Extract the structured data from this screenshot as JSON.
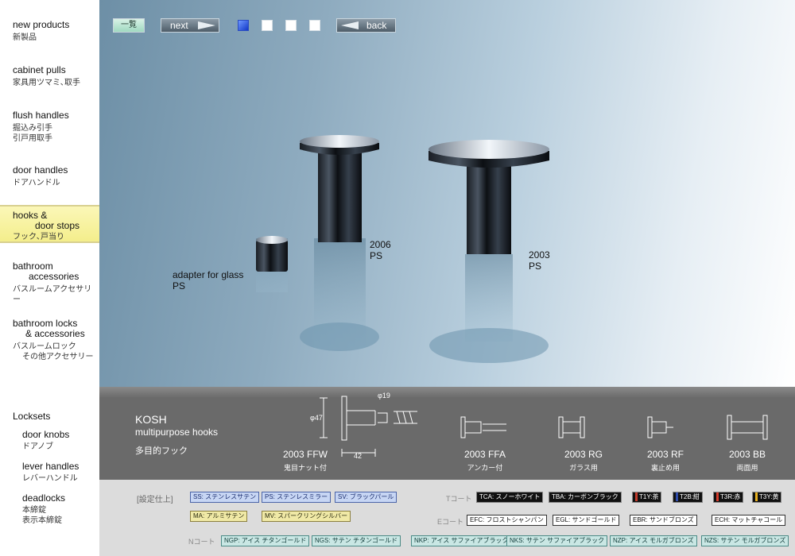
{
  "sidebar": {
    "new_products": {
      "en": "new products",
      "ja": "新製品"
    },
    "cabinet_pulls": {
      "en": "cabinet pulls",
      "ja": "家具用ツマミ､取手"
    },
    "flush_handles": {
      "en": "flush handles",
      "ja1": "掘込み引手",
      "ja2": "引戸用取手"
    },
    "door_handles": {
      "en": "door handles",
      "ja": "ドアハンドル"
    },
    "hooks": {
      "en1": "hooks &",
      "en2": "door stops",
      "ja": "フック､戸当り"
    },
    "bathroom_accessories": {
      "en1": "bathroom",
      "en2": "accessories",
      "ja": "バスルームアクセサリー"
    },
    "bathroom_locks": {
      "en1": "bathroom locks",
      "en2": "& accessories",
      "ja1": "バスルームロック",
      "ja2": "その他アクセサリー"
    },
    "locksets": {
      "title": "Locksets"
    },
    "door_knobs": {
      "en": "door knobs",
      "ja": "ドアノブ"
    },
    "lever_handles": {
      "en": "lever handles",
      "ja": "レバーハンドル"
    },
    "deadlocks": {
      "en": "deadlocks",
      "ja1": "本締錠",
      "ja2": "表示本締錠"
    }
  },
  "toolbar": {
    "list_label": "一覧",
    "next_label": "next",
    "back_label": "back",
    "pages_total": 4,
    "current_page": 1
  },
  "hero": {
    "label_adapter": "adapter for glass",
    "label_adapter_finish": "PS",
    "label_2006": "2006",
    "label_2006_finish": "PS",
    "label_2003": "2003",
    "label_2003_finish": "PS"
  },
  "spec": {
    "name": "KOSH",
    "subtitle": "multipurpose hooks",
    "ja": "多目的フック",
    "dim_dia": "φ19",
    "dim_dia47": "φ47",
    "dim_42": "42",
    "models": [
      {
        "code": "2003 FFW",
        "note": "鬼目ナット付"
      },
      {
        "code": "2003 FFA",
        "note": "アンカー付"
      },
      {
        "code": "2003 RG",
        "note": "ガラス用"
      },
      {
        "code": "2003 RF",
        "note": "裏止め用"
      },
      {
        "code": "2003 BB",
        "note": "両面用"
      }
    ]
  },
  "finishes": {
    "heading": "[設定仕上]",
    "t_coat": "Tコート",
    "e_coat": "Eコート",
    "n_coat": "Nコート",
    "row1_left": [
      {
        "code": "SS",
        "name": "ステンレスサテン"
      },
      {
        "code": "PS",
        "name": "ステンレスミラー"
      },
      {
        "code": "SV",
        "name": "ブラックパール"
      }
    ],
    "row1_right": [
      {
        "code": "TCA",
        "name": "スノーホワイト"
      },
      {
        "code": "TBA",
        "name": "カーボンブラック"
      }
    ],
    "row1_tone": [
      {
        "code": "T1Y",
        "name": "茶",
        "color": "#c0392b"
      },
      {
        "code": "T2B",
        "name": "紺",
        "color": "#2e4aa8"
      },
      {
        "code": "T3R",
        "name": "赤",
        "color": "#d43a2a"
      },
      {
        "code": "T3Y",
        "name": "黄",
        "color": "#e8b020"
      }
    ],
    "row2_left": [
      {
        "code": "MA",
        "name": "アルミサテン"
      },
      {
        "code": "MV",
        "name": "スパークリングシルバー"
      }
    ],
    "row2_right": [
      {
        "code": "EFC",
        "name": "フロストシャンパン"
      },
      {
        "code": "EGL",
        "name": "サンドゴールド"
      },
      {
        "code": "EBR",
        "name": "サンドブロンズ"
      },
      {
        "code": "ECH",
        "name": "マットチャコール"
      }
    ],
    "row3": [
      {
        "code": "NGP",
        "name": "アイス チタンゴールド"
      },
      {
        "code": "NGS",
        "name": "サテン チタンゴールド"
      },
      {
        "code": "NKP",
        "name": "アイス サファイアブラック"
      },
      {
        "code": "NKS",
        "name": "サテン サファイアブラック"
      },
      {
        "code": "NZP",
        "name": "アイス モルガブロンズ"
      },
      {
        "code": "NZS",
        "name": "サテン モルガブロンズ"
      }
    ]
  }
}
